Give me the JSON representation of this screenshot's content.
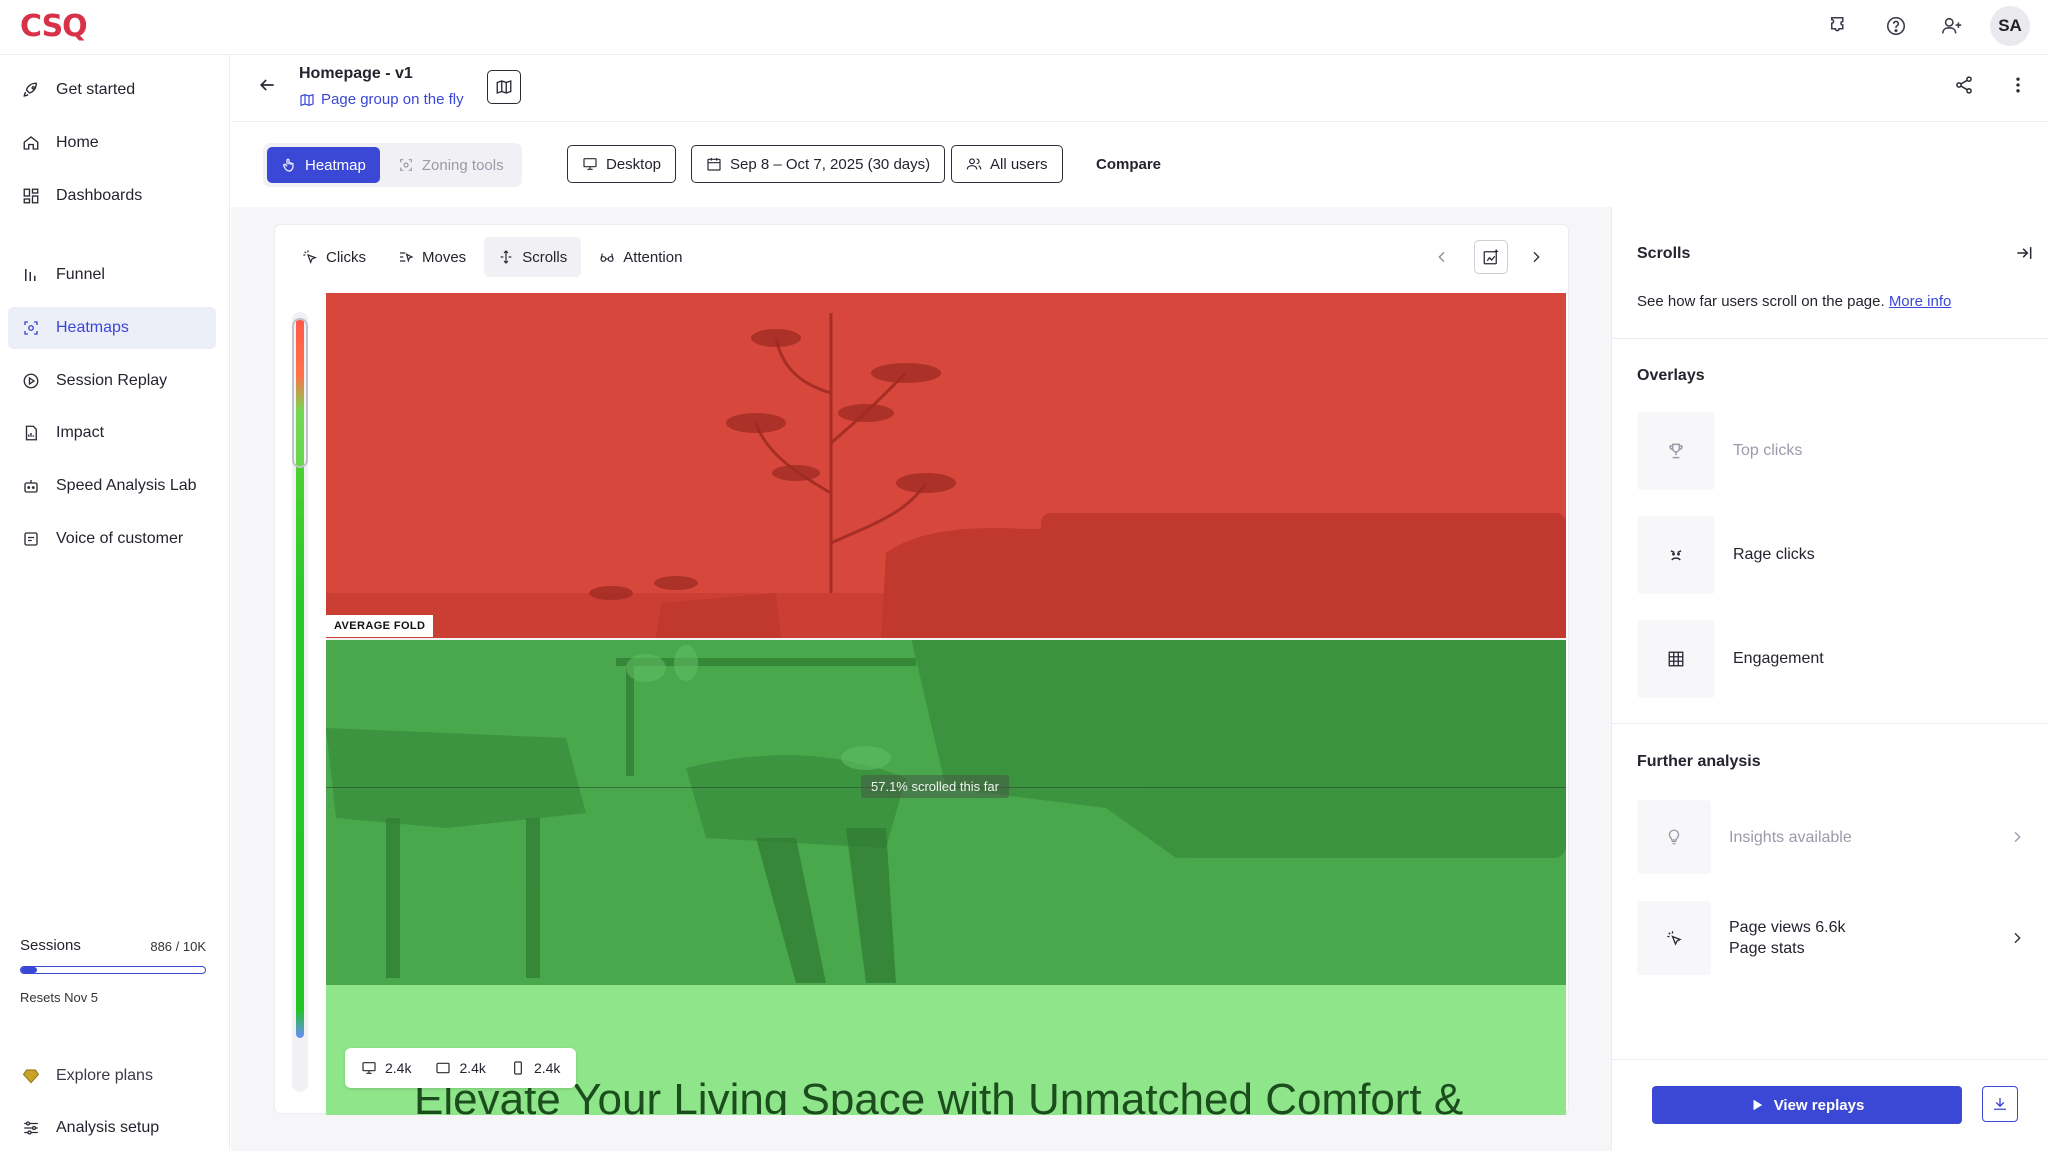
{
  "app": {
    "logo_text": "CSQ",
    "avatar_initials": "SA"
  },
  "sidebar": {
    "items": [
      {
        "label": "Get started",
        "icon": "rocket-icon"
      },
      {
        "label": "Home",
        "icon": "home-icon"
      },
      {
        "label": "Dashboards",
        "icon": "dashboard-icon"
      },
      {
        "label": "Funnel",
        "icon": "funnel-icon"
      },
      {
        "label": "Heatmaps",
        "icon": "heatmap-icon",
        "active": true
      },
      {
        "label": "Session Replay",
        "icon": "play-circle-icon"
      },
      {
        "label": "Impact",
        "icon": "document-chart-icon"
      },
      {
        "label": "Speed Analysis Lab",
        "icon": "robot-icon"
      },
      {
        "label": "Voice of customer",
        "icon": "feedback-icon"
      }
    ],
    "sessions": {
      "label": "Sessions",
      "count": "886 / 10K",
      "used_fraction": 0.0886,
      "resets": "Resets Nov 5"
    },
    "explore_plans": "Explore plans",
    "analysis_setup": "Analysis setup"
  },
  "header": {
    "title": "Homepage - v1",
    "page_group": "Page group on the fly"
  },
  "toolbar": {
    "heatmap_label": "Heatmap",
    "zoning_label": "Zoning tools",
    "device_label": "Desktop",
    "date_range": "Sep 8 – Oct 7, 2025 (30 days)",
    "segment_label": "All users",
    "compare_label": "Compare"
  },
  "heatmap_tabs": [
    {
      "label": "Clicks"
    },
    {
      "label": "Moves"
    },
    {
      "label": "Scrolls",
      "selected": true
    },
    {
      "label": "Attention"
    }
  ],
  "heatmap": {
    "fold_label": "AVERAGE FOLD",
    "scroll_tooltip": "57.1% scrolled this far",
    "hero_text": "Elevate Your Living Space with Unmatched Comfort &",
    "devices": [
      {
        "icon": "desktop-icon",
        "count": "2.4k"
      },
      {
        "icon": "tablet-icon",
        "count": "2.4k"
      },
      {
        "icon": "mobile-icon",
        "count": "2.4k"
      }
    ]
  },
  "right_panel": {
    "title": "Scrolls",
    "description": "See how far users scroll on the page.",
    "more_info": "More info",
    "overlays_title": "Overlays",
    "overlays": [
      {
        "label": "Top clicks",
        "icon": "trophy-icon",
        "enabled": false
      },
      {
        "label": "Rage clicks",
        "icon": "rage-face-icon",
        "enabled": true
      },
      {
        "label": "Engagement",
        "icon": "grid-icon",
        "enabled": true
      }
    ],
    "further_title": "Further analysis",
    "insights_label": "Insights available",
    "page_views_label": "Page views 6.6k",
    "page_stats_label": "Page stats",
    "view_replays": "View replays"
  }
}
